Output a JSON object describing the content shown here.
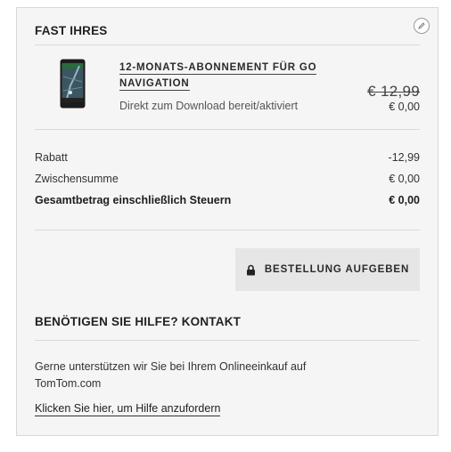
{
  "cart": {
    "title": "FAST IHRES",
    "edit_icon": "pencil-icon",
    "product": {
      "name": "12-MONATS-ABONNEMENT FÜR GO NAVIGATION",
      "subtitle": "Direkt zum Download bereit/aktiviert",
      "old_price": "€ 12,99",
      "new_price": "€ 0,00"
    },
    "summary": [
      {
        "label": "Rabatt",
        "value": "-12,99"
      },
      {
        "label": "Zwischensumme",
        "value": "€ 0,00"
      },
      {
        "label": "Gesamtbetrag einschließlich Steuern",
        "value": "€ 0,00"
      }
    ],
    "order_button": {
      "label": "BESTELLUNG AUFGEBEN",
      "icon": "lock-icon"
    }
  },
  "help": {
    "title": "BENÖTIGEN SIE HILFE? KONTAKT",
    "text": "Gerne unterstützen wir Sie bei Ihrem Onlineeinkauf auf TomTom.com",
    "link": "Klicken Sie hier, um Hilfe anzufordern"
  }
}
